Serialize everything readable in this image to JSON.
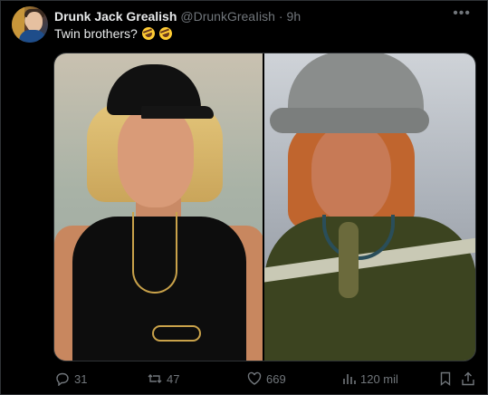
{
  "tweet": {
    "author_name": "Drunk Jack Grealish",
    "author_handle": "@DrunkGreaIish",
    "separator": "·",
    "timestamp": "9h",
    "text": "Twin brothers?",
    "emoji": [
      "rolling-on-floor-laughing",
      "rolling-on-floor-laughing"
    ],
    "more_icon": "ellipsis-icon"
  },
  "media": {
    "panes": [
      "left-photo",
      "right-photo"
    ]
  },
  "actions": {
    "replies": "31",
    "reposts": "47",
    "likes": "669",
    "views": "120 mil"
  },
  "colors": {
    "background": "#000000",
    "text_primary": "#e7e9ea",
    "text_secondary": "#71767b",
    "border": "#2f3336"
  }
}
